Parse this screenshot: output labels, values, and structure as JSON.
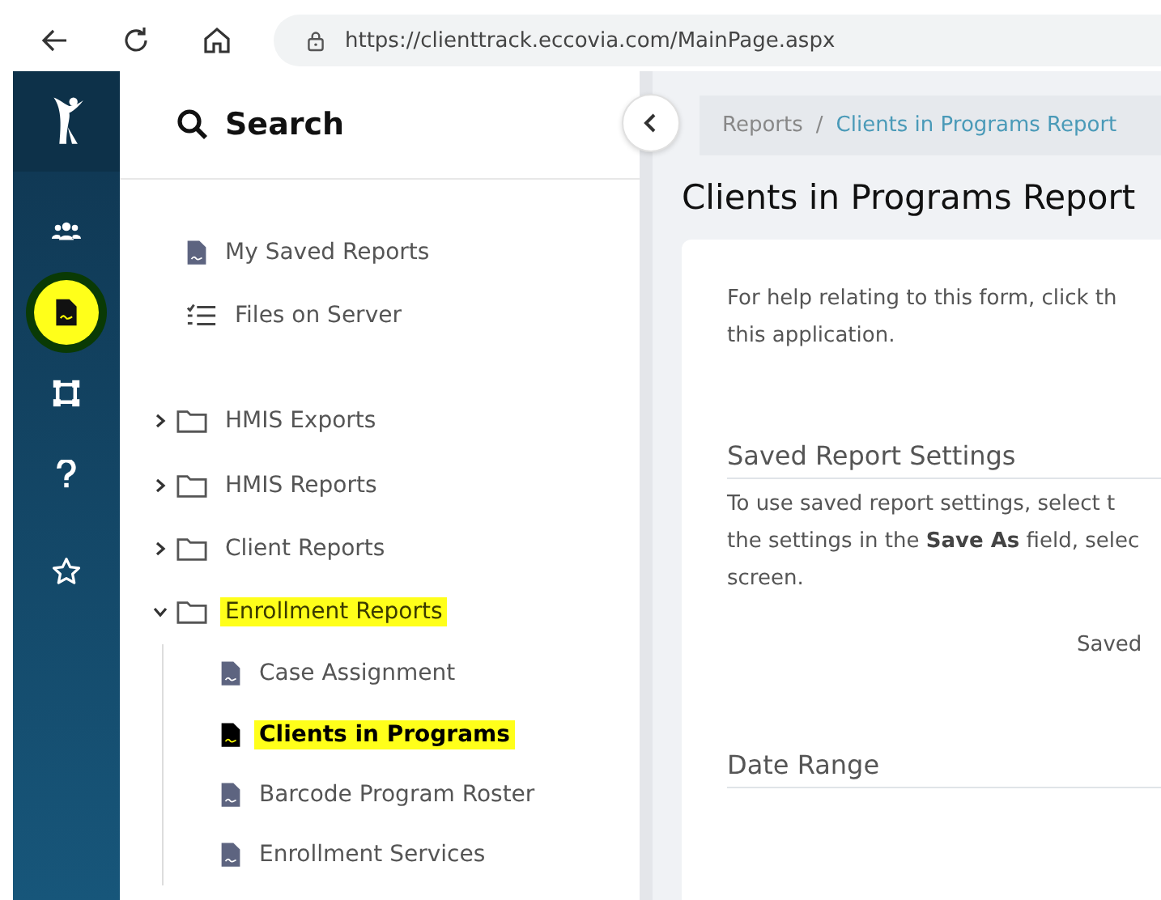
{
  "browser": {
    "url": "https://clienttrack.eccovia.com/MainPage.aspx"
  },
  "rail": {
    "items": [
      {
        "kind": "users",
        "highlighted": false
      },
      {
        "kind": "report",
        "highlighted": true
      },
      {
        "kind": "nodes",
        "highlighted": false
      },
      {
        "kind": "help",
        "highlighted": false
      },
      {
        "kind": "star",
        "highlighted": false
      }
    ]
  },
  "sidebar": {
    "title": "Search",
    "items": [
      {
        "kind": "report",
        "label": "My Saved Reports",
        "highlighted": false
      },
      {
        "kind": "files",
        "label": "Files on Server",
        "highlighted": false
      },
      {
        "kind": "folder",
        "label": "HMIS Exports",
        "expanded": false,
        "highlighted": false
      },
      {
        "kind": "folder",
        "label": "HMIS Reports",
        "expanded": false,
        "highlighted": false
      },
      {
        "kind": "folder",
        "label": "Client Reports",
        "expanded": false,
        "highlighted": false
      },
      {
        "kind": "folder",
        "label": "Enrollment Reports",
        "expanded": true,
        "highlighted": true,
        "children": [
          {
            "label": "Case Assignment",
            "highlighted": false
          },
          {
            "label": "Clients in Programs",
            "highlighted": true
          },
          {
            "label": "Barcode Program Roster",
            "highlighted": false
          },
          {
            "label": "Enrollment Services",
            "highlighted": false
          }
        ]
      }
    ]
  },
  "breadcrumb": {
    "separator": "/",
    "items": [
      "Reports",
      "Clients in Programs Report"
    ]
  },
  "page": {
    "title": "Clients in Programs Report",
    "help_lines": [
      "For help relating to this form, click th",
      "this application."
    ],
    "sections": [
      {
        "heading": "Saved Report Settings",
        "lines": [
          "To use saved report settings, select t",
          "the settings in the **Save As** field, selec",
          "screen."
        ],
        "field_label": "Saved"
      },
      {
        "heading": "Date Range"
      }
    ]
  }
}
